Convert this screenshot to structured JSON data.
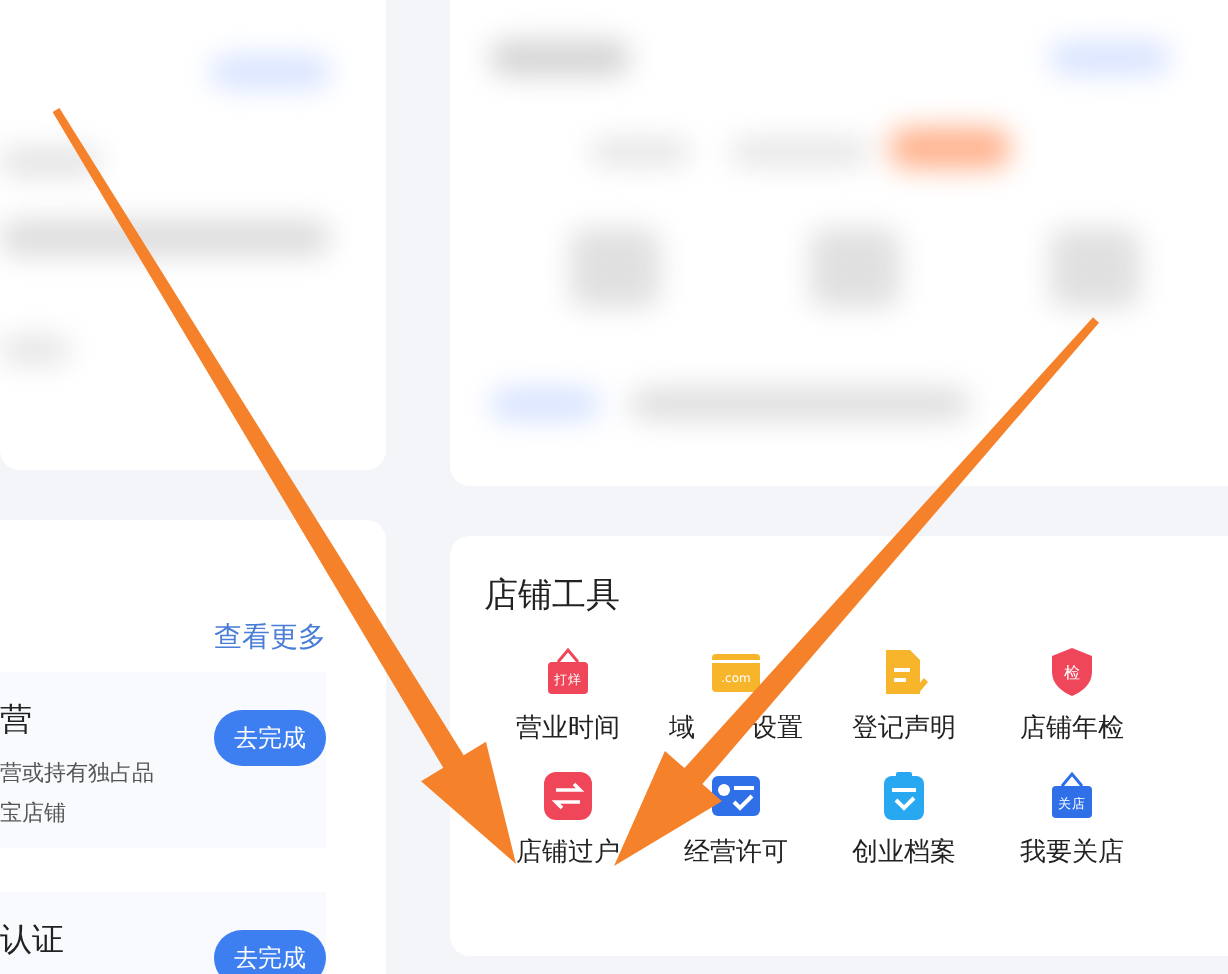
{
  "tasks": {
    "more_link": "查看更多",
    "items": [
      {
        "title": "营",
        "lines": [
          "营或持有独占品",
          "宝店铺"
        ],
        "button": "去完成"
      },
      {
        "title": "认证",
        "button": "去完成"
      }
    ]
  },
  "tools": {
    "title": "店铺工具",
    "items": [
      {
        "label": "营业时间",
        "kind": "sign",
        "color": "#f0465a",
        "badge": "打烊"
      },
      {
        "label": "域",
        "label_tail": "设置",
        "kind": "web",
        "color": "#f7b52c",
        "badge": ".com"
      },
      {
        "label": "登记声明",
        "kind": "doc",
        "color": "#f7b52c"
      },
      {
        "label": "店铺年检",
        "kind": "shield",
        "color": "#f0465a",
        "badge": "检"
      },
      {
        "label": "店铺过户",
        "kind": "swap",
        "color": "#f0465a"
      },
      {
        "label": "经营许可",
        "kind": "license",
        "color": "#2f6fe8"
      },
      {
        "label": "创业档案",
        "kind": "clipboard",
        "color": "#27a8f0"
      },
      {
        "label": "我要关店",
        "kind": "sign",
        "color": "#2f6fe8",
        "badge": "关店"
      }
    ]
  },
  "annotations": [
    {
      "kind": "arrow",
      "color": "#f5822a"
    },
    {
      "kind": "arrow",
      "color": "#f5822a"
    }
  ]
}
